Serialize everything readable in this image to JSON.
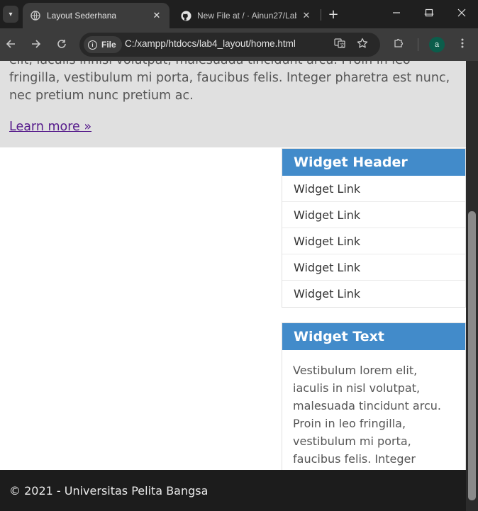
{
  "browser": {
    "tabs": [
      {
        "title": "Layout Sederhana",
        "active": true,
        "favicon": "globe-icon"
      },
      {
        "title": "New File at / · Ainun27/Lab",
        "active": false,
        "favicon": "github-icon"
      }
    ],
    "url": "C:/xampp/htdocs/lab4_layout/home.html",
    "url_chip": "File",
    "profile_initial": "a",
    "profile_color": "#0b5d4b"
  },
  "hero": {
    "text": "elit, iaculis innisi volutpat, malesuada tincidunt arcu. Proin in leo fringilla, vestibulum mi porta, faucibus felis. Integer pharetra est nunc, nec pretium nunc pretium ac.",
    "link": "Learn more »"
  },
  "widget_links": {
    "header": "Widget Header",
    "links": [
      "Widget Link",
      "Widget Link",
      "Widget Link",
      "Widget Link",
      "Widget Link"
    ]
  },
  "widget_text": {
    "header": "Widget Text",
    "body": "Vestibulum lorem elit, iaculis in nisl volutpat, malesuada tincidunt arcu. Proin in leo fringilla, vestibulum mi porta, faucibus felis. Integer pharetra est nunc, nec pretium nunc pretium ac."
  },
  "footer": {
    "text": "© 2021 - Universitas Pelita Bangsa"
  },
  "colors": {
    "widget_header": "#428bca",
    "footer": "#1c1c1c",
    "hero": "#e0e0e0"
  }
}
